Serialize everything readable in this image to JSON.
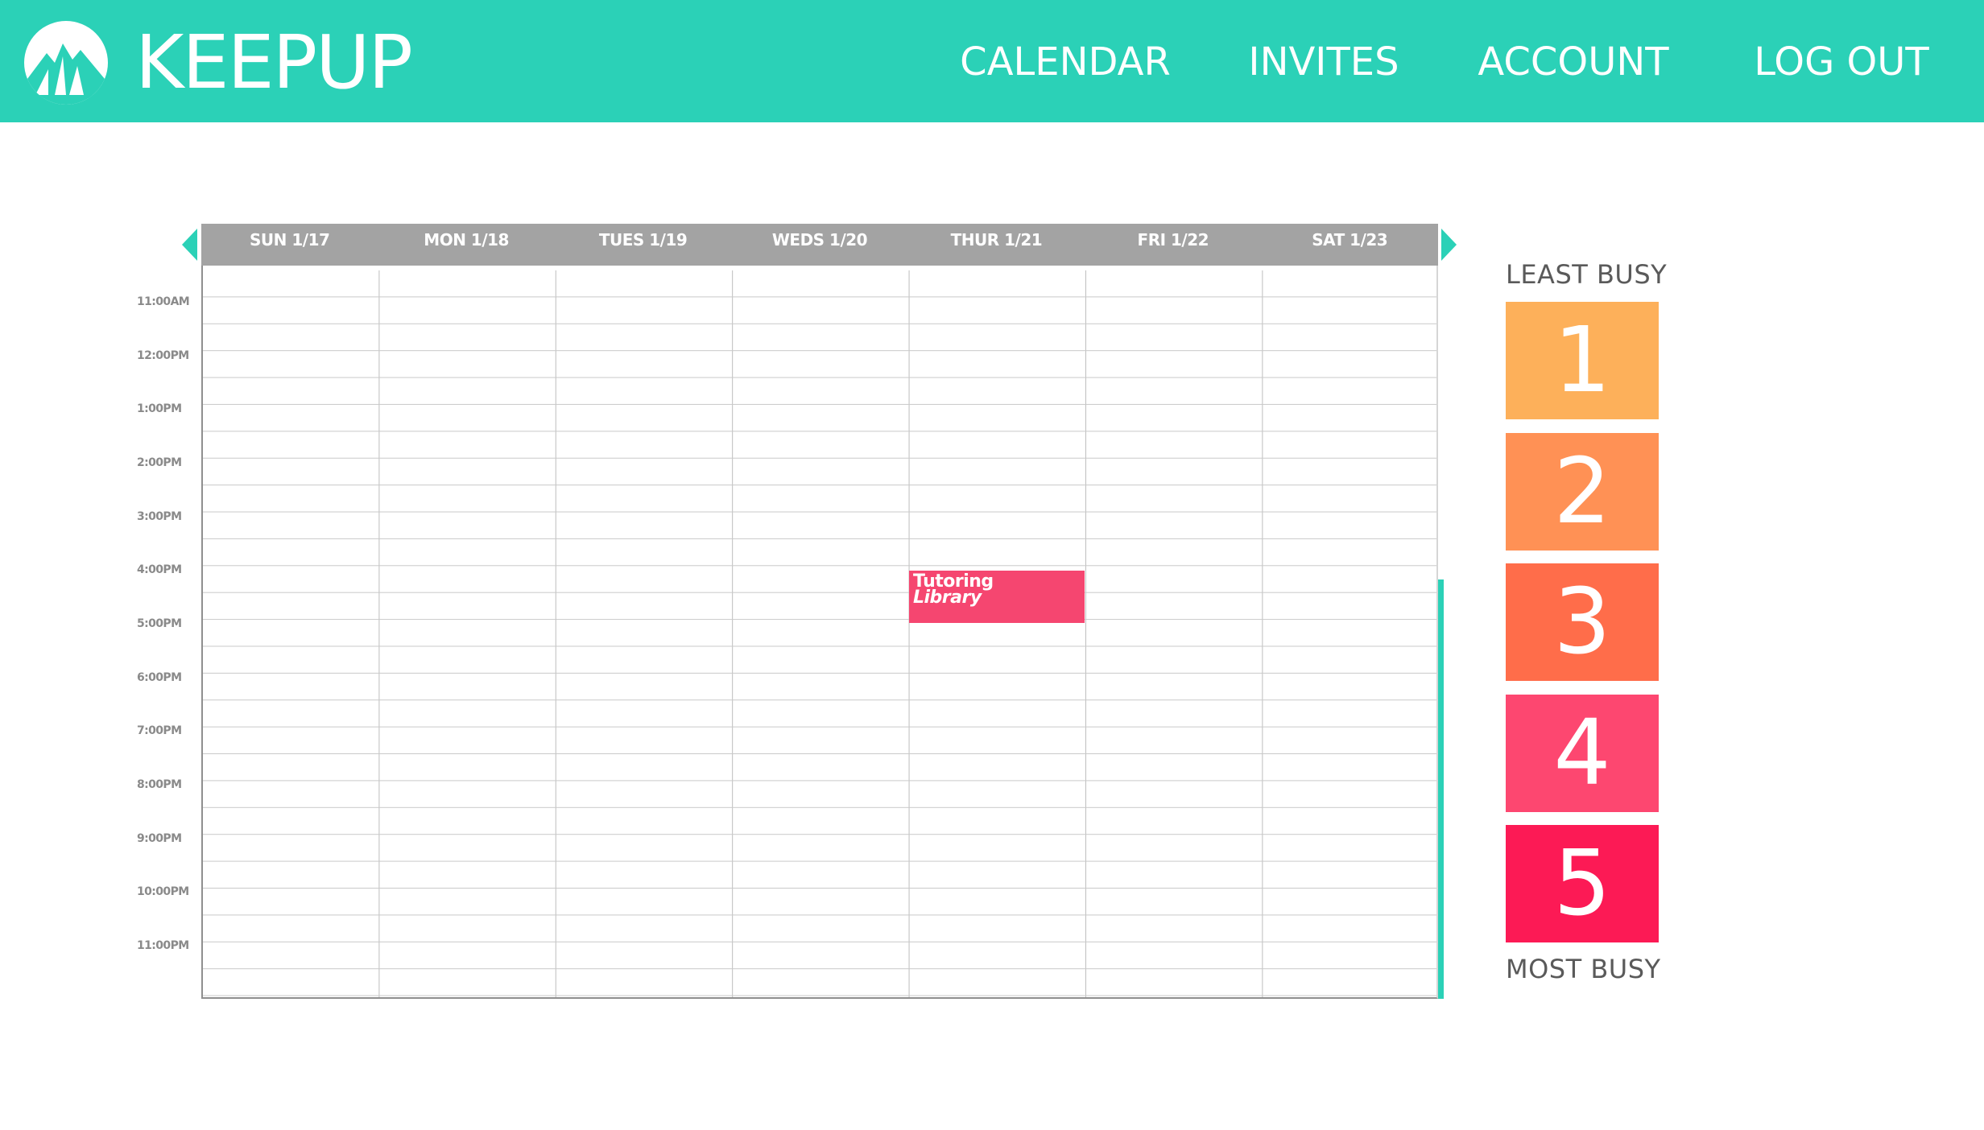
{
  "brand": {
    "name": "KEEPUP",
    "logo_icon": "mountain-icon",
    "color": "#2bd1b7"
  },
  "nav": {
    "items": [
      {
        "label": "CALENDAR"
      },
      {
        "label": "INVITES"
      },
      {
        "label": "ACCOUNT"
      },
      {
        "label": "LOG OUT"
      }
    ]
  },
  "calendar": {
    "prev_icon": "chevron-left-icon",
    "next_icon": "chevron-right-icon",
    "days": [
      {
        "label": "SUN 1/17"
      },
      {
        "label": "MON 1/18"
      },
      {
        "label": "TUES 1/19"
      },
      {
        "label": "WEDS 1/20"
      },
      {
        "label": "THUR 1/21"
      },
      {
        "label": "FRI 1/22"
      },
      {
        "label": "SAT 1/23"
      }
    ],
    "times": [
      "11:00AM",
      "12:00PM",
      "1:00PM",
      "2:00PM",
      "3:00PM",
      "4:00PM",
      "5:00PM",
      "6:00PM",
      "7:00PM",
      "8:00PM",
      "9:00PM",
      "10:00PM",
      "11:00PM"
    ],
    "events": [
      {
        "title": "Tutoring",
        "location": "Library",
        "day": "THUR 1/21",
        "start": "4:00PM",
        "end": "5:00PM",
        "busy_level": 4,
        "color": "#f54670"
      }
    ]
  },
  "busy_legend": {
    "top_label": "LEAST BUSY",
    "bottom_label": "MOST BUSY",
    "levels": [
      {
        "value": "1",
        "color": "#fdb05a"
      },
      {
        "value": "2",
        "color": "#ff9155"
      },
      {
        "value": "3",
        "color": "#ff6d4a"
      },
      {
        "value": "4",
        "color": "#fd4770"
      },
      {
        "value": "5",
        "color": "#fc1a55"
      }
    ]
  }
}
